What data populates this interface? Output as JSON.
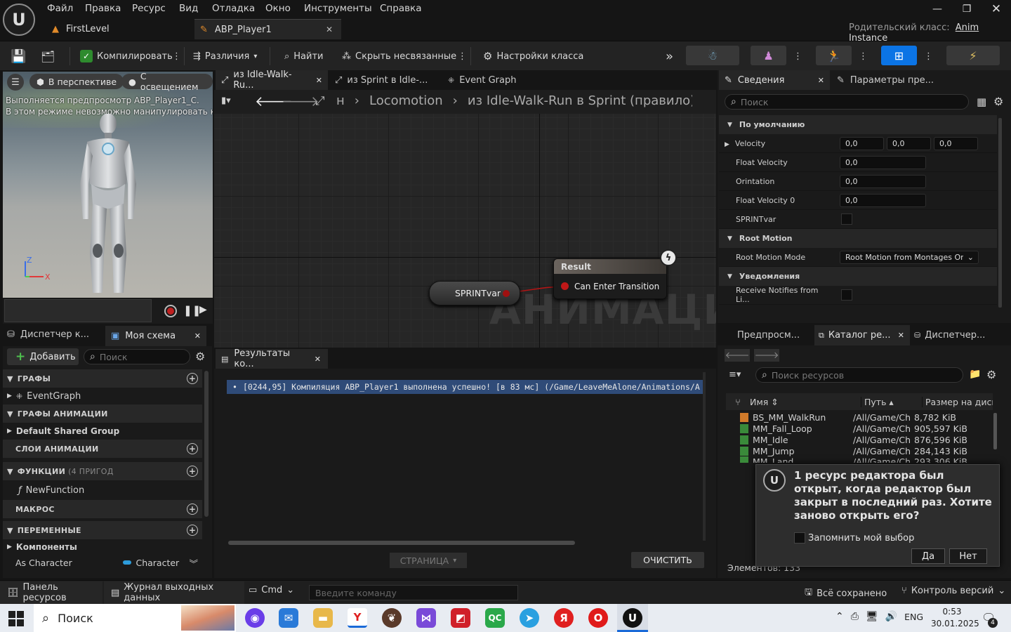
{
  "menu": [
    "Файл",
    "Правка",
    "Ресурс",
    "Вид",
    "Отладка",
    "Окно",
    "Инструменты",
    "Справка"
  ],
  "tabs": {
    "first_level": "FirstLevel",
    "abp_player": "ABP_Player1"
  },
  "parent_class": {
    "label": "Родительский класс:",
    "value": "Anim Instance"
  },
  "toolbar": {
    "compile": "Компилировать",
    "diff": "Различия",
    "find": "Найти",
    "hide_unrelated": "Скрыть несвязанные",
    "class_settings": "Настройки класса"
  },
  "viewport": {
    "perspective": "В перспективе",
    "lit": "С освещением",
    "preview_line1": "Выполняется предпросмотр ABP_Player1_C.",
    "preview_line2": "В этом режиме невозможно манипулировать ко"
  },
  "left_tabs": {
    "dispatcher": "Диспетчер к...",
    "my_blueprint": "Моя схема"
  },
  "my_blueprint": {
    "add": "Добавить",
    "search_placeholder": "Поиск",
    "graphs": "ГРАФЫ",
    "event_graph": "EventGraph",
    "anim_graphs": "ГРАФЫ АНИМАЦИИ",
    "default_shared": "Default Shared Group",
    "anim_layers": "СЛОИ АНИМАЦИИ",
    "functions": "ФУНКЦИИ",
    "functions_count": "(4 ПРИГОД",
    "new_function": "NewFunction",
    "macros": "МАКРОС",
    "variables": "ПЕРЕМЕННЫЕ",
    "components": "Компоненты",
    "as_character": "As Character",
    "character_type": "Character"
  },
  "graph_tabs": {
    "tab1": "из Idle-Walk-Ru...",
    "tab2": "из Sprint в Idle-...",
    "tab3": "Event Graph"
  },
  "breadcrumb": {
    "partial": "н",
    "locomotion": "Locomotion",
    "rule": "из Idle-Walk-Run в Sprint (правило)"
  },
  "graph": {
    "result_title": "Result",
    "can_enter": "Can Enter Transition",
    "var_node": "SPRINTvar",
    "watermark": "АНИМАЦИЯ"
  },
  "results": {
    "tab": "Результаты ко...",
    "line": "[0244,95] Компиляция ABP_Player1 выполнена успешно! [в 83 мс] (/Game/LeaveMeAlone/Animations/A",
    "page": "СТРАНИЦА",
    "clear": "ОЧИСТИТЬ"
  },
  "details": {
    "tab1": "Сведения",
    "tab2": "Параметры пре...",
    "search_placeholder": "Поиск",
    "default_section": "По умолчанию",
    "props": [
      {
        "name": "Velocity",
        "values": [
          "0,0",
          "0,0",
          "0,0"
        ]
      },
      {
        "name": "Float Velocity",
        "values": [
          "0,0"
        ]
      },
      {
        "name": "Orintation",
        "values": [
          "0,0"
        ]
      },
      {
        "name": "Float Velocity 0",
        "values": [
          "0,0"
        ]
      },
      {
        "name": "SPRINTvar",
        "checkbox": true
      }
    ],
    "root_motion_section": "Root Motion",
    "root_motion_mode": "Root Motion Mode",
    "root_motion_value": "Root Motion from Montages Only",
    "notifies_section": "Уведомления",
    "receive_notifies": "Receive Notifies from Li..."
  },
  "content_tabs": {
    "preview": "Предпросм...",
    "catalog": "Каталог ре...",
    "dispatcher": "Диспетчер..."
  },
  "content": {
    "search_placeholder": "Поиск ресурсов",
    "columns": {
      "name": "Имя",
      "path": "Путь",
      "size": "Размер на диск"
    },
    "rows": [
      {
        "name": "BS_MM_WalkRun",
        "path": "/All/Game/Ch",
        "size": "8,782 KiB"
      },
      {
        "name": "MM_Fall_Loop",
        "path": "/All/Game/Ch",
        "size": "905,597 KiB"
      },
      {
        "name": "MM_Idle",
        "path": "/All/Game/Ch",
        "size": "876,596 KiB"
      },
      {
        "name": "MM_Jump",
        "path": "/All/Game/Ch",
        "size": "284,143 KiB"
      },
      {
        "name": "MM_Land",
        "path": "/All/Game/Ch",
        "size": "293,306 KiB"
      }
    ],
    "elements": "Элементов: 133"
  },
  "toast": {
    "message": "1 ресурс редактора был открыт, когда редактор был закрыт в последний раз. Хотите заново открыть его?",
    "remember": "Запомнить мой выбор",
    "yes": "Да",
    "no": "Нет"
  },
  "statusbar": {
    "content_drawer": "Панель ресурсов",
    "output_log": "Журнал выходных данных",
    "cmd": "Cmd",
    "cmd_placeholder": "Введите  команду",
    "saved": "Всё сохранено",
    "source_control": "Контроль версий"
  },
  "taskbar": {
    "search": "Поиск",
    "lang": "ENG",
    "time": "0:53",
    "date": "30.01.2025",
    "notif_count": "4"
  }
}
